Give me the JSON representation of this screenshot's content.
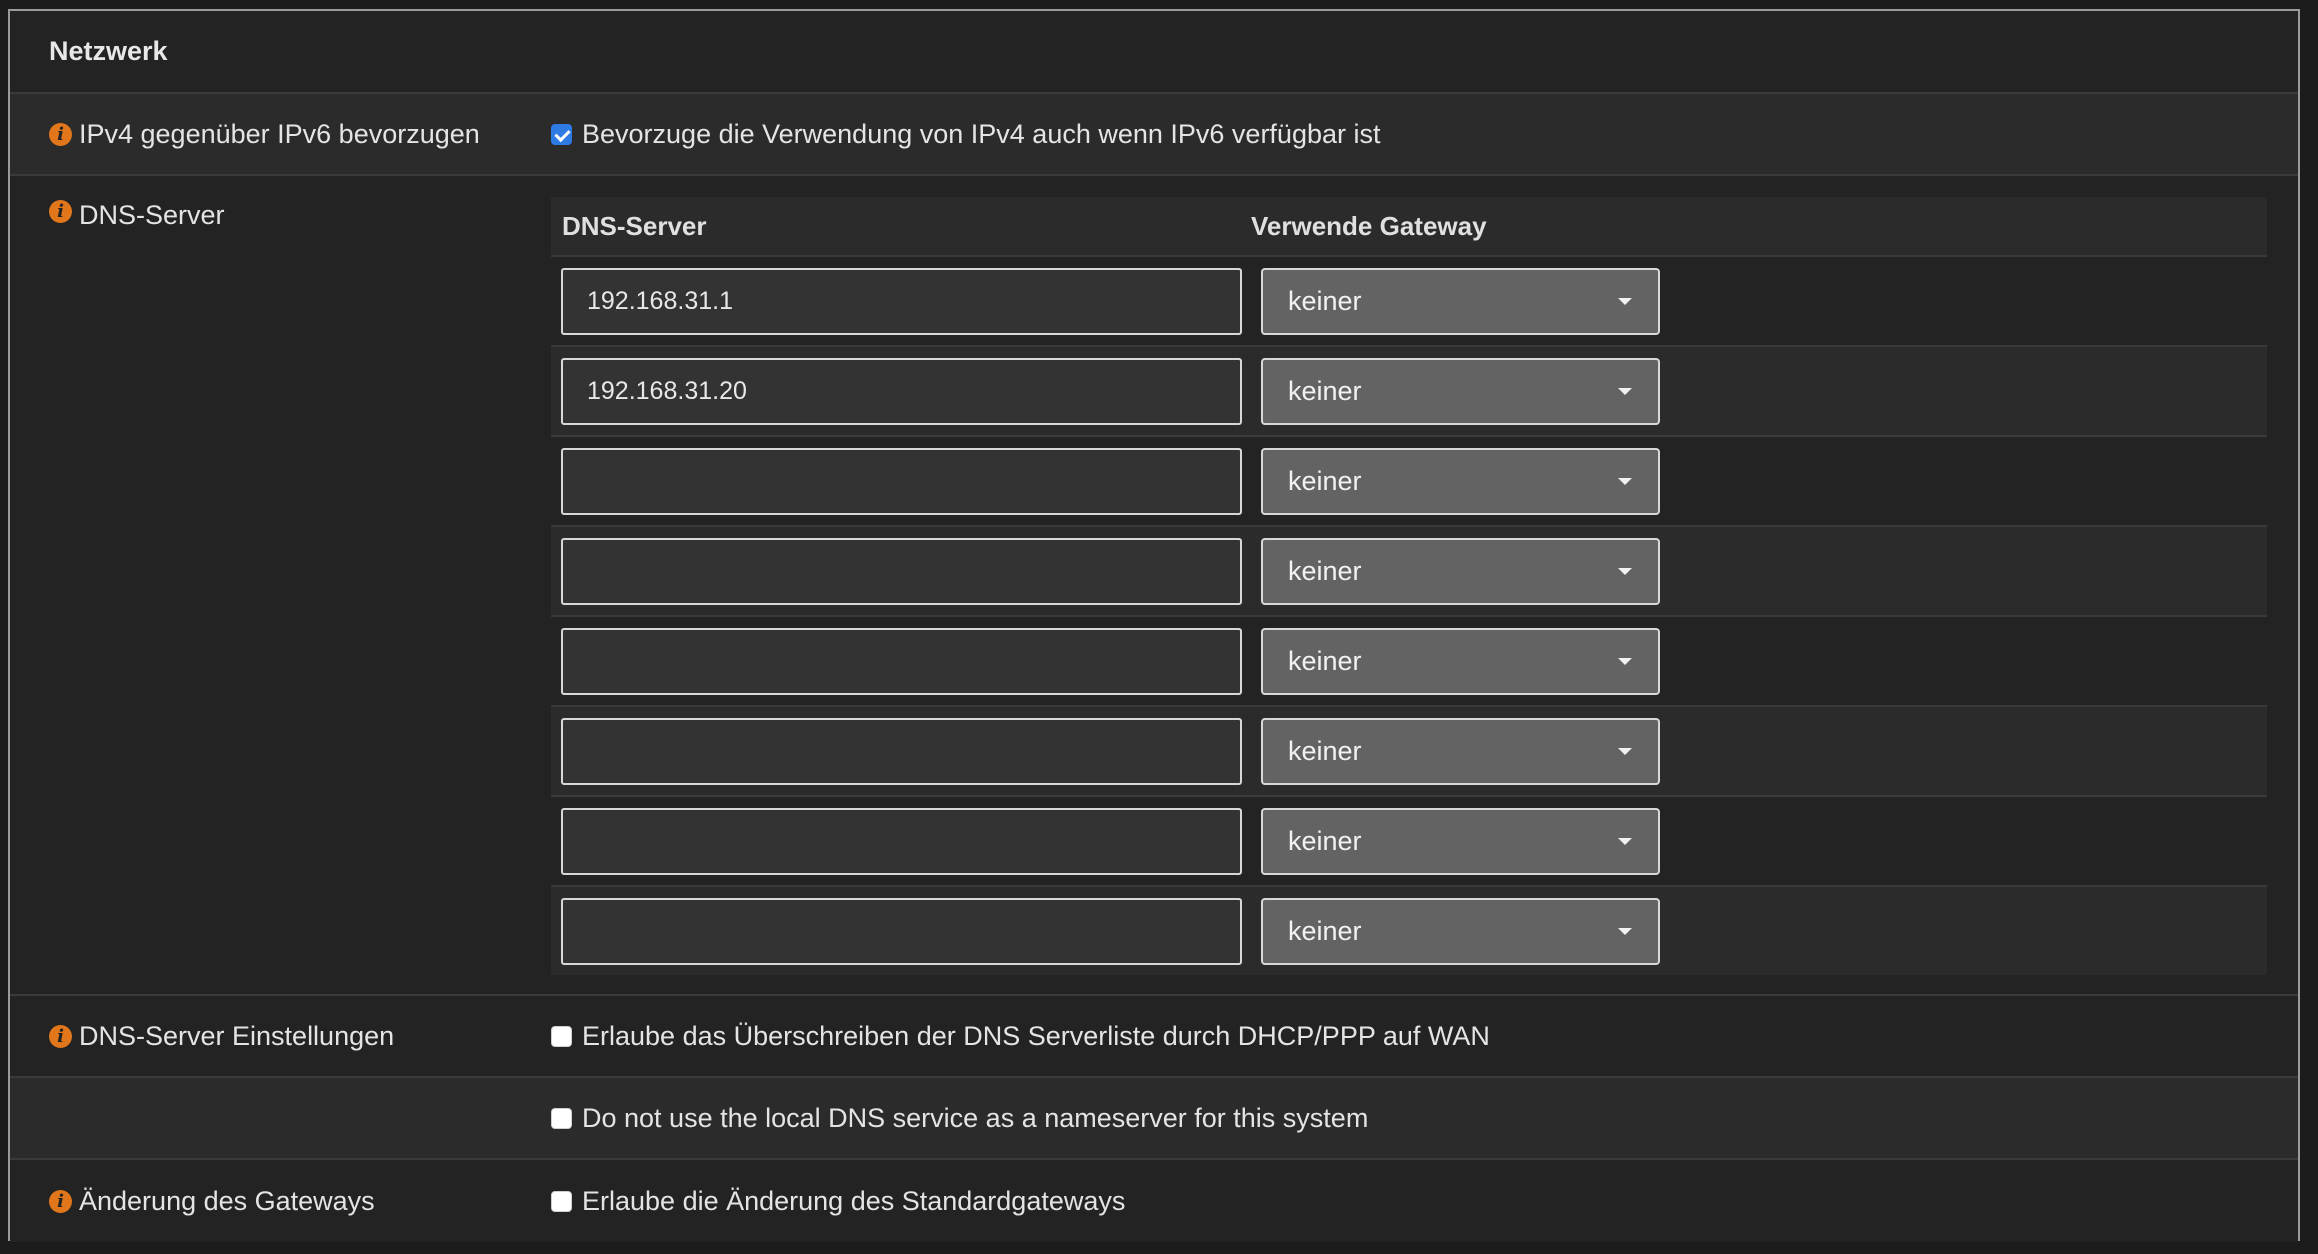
{
  "panel": {
    "title": "Netzwerk"
  },
  "ipv4_pref": {
    "label": "IPv4 gegenüber IPv6 bevorzugen",
    "checkbox_label": "Bevorzuge die Verwendung von IPv4 auch wenn IPv6 verfügbar ist",
    "checked": true
  },
  "dns": {
    "label": "DNS-Server",
    "col_server": "DNS-Server",
    "col_gateway": "Verwende Gateway",
    "entries": [
      {
        "server": "192.168.31.1",
        "gateway": "keiner"
      },
      {
        "server": "192.168.31.20",
        "gateway": "keiner"
      },
      {
        "server": "",
        "gateway": "keiner"
      },
      {
        "server": "",
        "gateway": "keiner"
      },
      {
        "server": "",
        "gateway": "keiner"
      },
      {
        "server": "",
        "gateway": "keiner"
      },
      {
        "server": "",
        "gateway": "keiner"
      },
      {
        "server": "",
        "gateway": "keiner"
      }
    ]
  },
  "dns_settings": {
    "label": "DNS-Server Einstellungen",
    "allow_override": {
      "text": "Erlaube das Überschreiben der DNS Serverliste durch DHCP/PPP auf WAN",
      "checked": false
    },
    "no_local_dns": {
      "text": "Do not use the local DNS service as a nameserver for this system",
      "checked": false
    }
  },
  "gateway_change": {
    "label": "Änderung des Gateways",
    "allow_change": {
      "text": "Erlaube die Änderung des Standardgateways",
      "checked": false
    }
  },
  "icons": {
    "info": "info-circle-icon",
    "dropdown": "caret-down-icon"
  },
  "colors": {
    "accent_info": "#e2761b",
    "checkbox_checked": "#2e7be3"
  }
}
